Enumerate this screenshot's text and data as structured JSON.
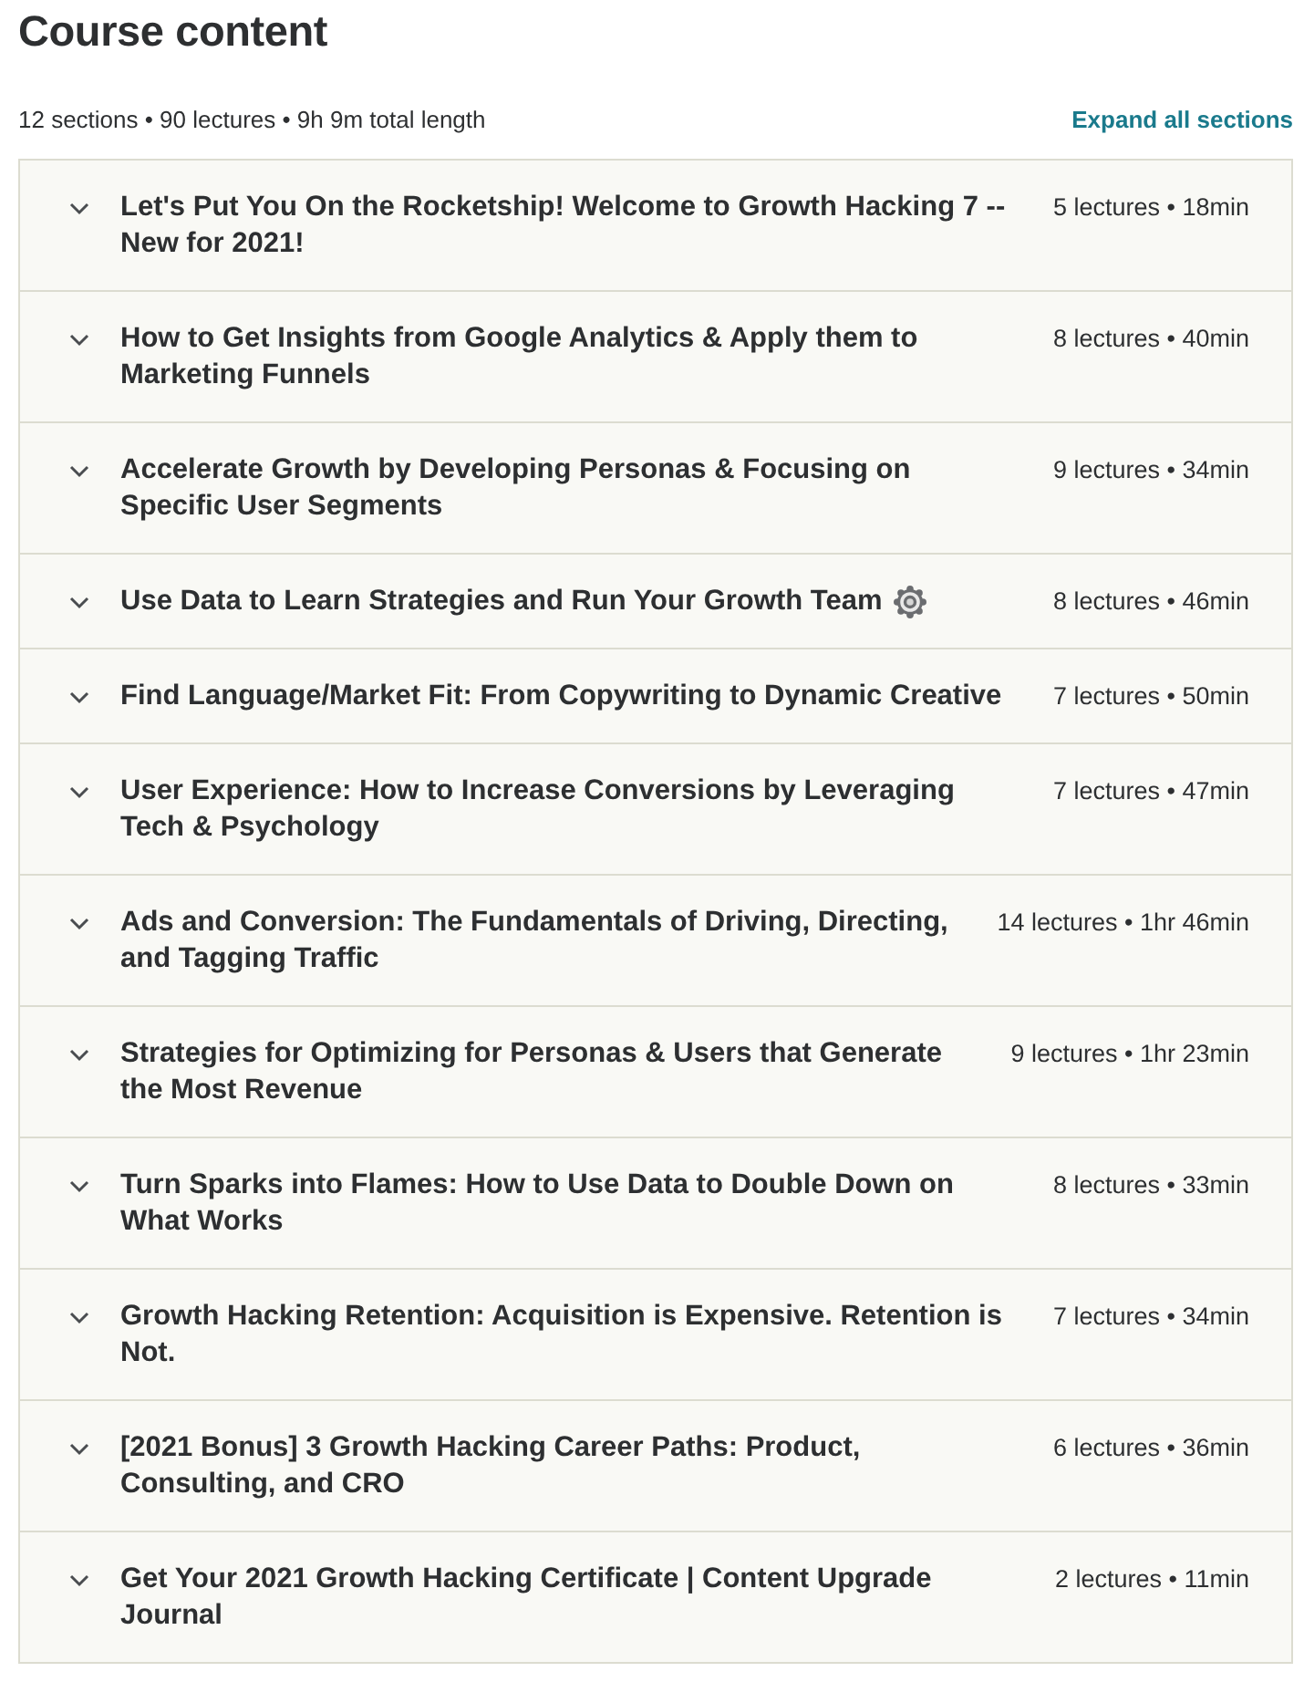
{
  "heading": "Course content",
  "summary": "12 sections • 90 lectures • 9h 9m total length",
  "expand_link": "Expand all sections",
  "sections": [
    {
      "title": "Let's Put You On the Rocketship! Welcome to Growth Hacking 7 -- New for 2021!",
      "meta": "5 lectures • 18min",
      "expanded": false,
      "has_icon": false
    },
    {
      "title": "How to Get Insights from Google Analytics & Apply them to Marketing Funnels",
      "meta": "8 lectures • 40min",
      "expanded": false,
      "has_icon": false
    },
    {
      "title": "Accelerate Growth by Developing Personas & Focusing on Specific User Segments",
      "meta": "9 lectures • 34min",
      "expanded": false,
      "has_icon": false
    },
    {
      "title": "Use Data to Learn Strategies and Run Your Growth Team",
      "meta": "8 lectures • 46min",
      "expanded": false,
      "has_icon": true
    },
    {
      "title": "Find Language/Market Fit: From Copywriting to Dynamic Creative",
      "meta": "7 lectures • 50min",
      "expanded": false,
      "has_icon": false
    },
    {
      "title": "User Experience: How to Increase Conversions by Leveraging Tech & Psychology",
      "meta": "7 lectures • 47min",
      "expanded": false,
      "has_icon": false
    },
    {
      "title": "Ads and Conversion: The Fundamentals of Driving, Directing, and Tagging Traffic",
      "meta": "14 lectures • 1hr 46min",
      "expanded": false,
      "has_icon": false
    },
    {
      "title": "Strategies for Optimizing for Personas & Users that Generate the Most Revenue",
      "meta": "9 lectures • 1hr 23min",
      "expanded": false,
      "has_icon": false
    },
    {
      "title": "Turn Sparks into Flames: How to Use Data to Double Down on What Works",
      "meta": "8 lectures • 33min",
      "expanded": false,
      "has_icon": false
    },
    {
      "title": "Growth Hacking Retention: Acquisition is Expensive. Retention is Not.",
      "meta": "7 lectures • 34min",
      "expanded": false,
      "has_icon": false
    },
    {
      "title": "[2021 Bonus] 3 Growth Hacking Career Paths: Product, Consulting, and CRO",
      "meta": "6 lectures • 36min",
      "expanded": false,
      "has_icon": false
    },
    {
      "title": "Get Your 2021 Growth Hacking Certificate | Content Upgrade Journal",
      "meta": "2 lectures • 11min",
      "expanded": false,
      "has_icon": false
    }
  ]
}
